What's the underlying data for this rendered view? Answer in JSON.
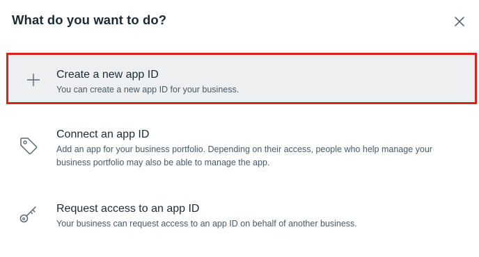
{
  "dialog": {
    "title": "What do you want to do?",
    "close_icon": "close-icon"
  },
  "options": [
    {
      "icon": "plus-icon",
      "title": "Create a new app ID",
      "description": "You can create a new app ID for your business.",
      "selected": true
    },
    {
      "icon": "tag-icon",
      "title": "Connect an app ID",
      "description": "Add an app for your business portfolio. Depending on their access, people who help manage your business portfolio may also be able to manage the app.",
      "selected": false
    },
    {
      "icon": "key-icon",
      "title": "Request access to an app ID",
      "description": "Your business can request access to an app ID on behalf of another business.",
      "selected": false
    }
  ],
  "colors": {
    "highlight_border": "#e0201b",
    "selected_background": "#eeeff0",
    "text_primary": "#1c2b33",
    "text_secondary": "#465a69"
  }
}
